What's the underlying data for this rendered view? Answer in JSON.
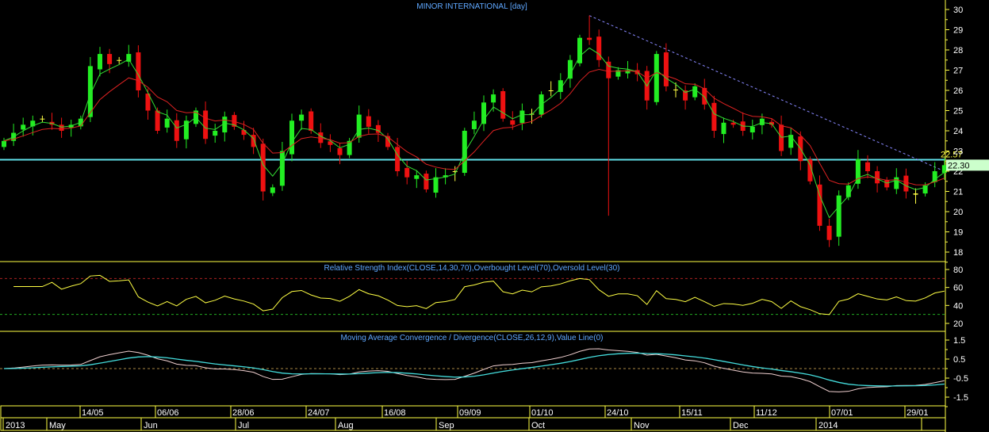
{
  "chart_data": {
    "type": "candlestick",
    "title": "MINOR INTERNATIONAL [day]",
    "price_axis": {
      "ticks": [
        18,
        19,
        20,
        21,
        22,
        23,
        24,
        25,
        26,
        27,
        28,
        29,
        30
      ],
      "range": [
        17.7,
        30.5
      ]
    },
    "closes": [
      23.5,
      23.9,
      24.3,
      24.5,
      24.6,
      24.3,
      24.0,
      24.3,
      24.6,
      27.2,
      27.8,
      27.3,
      27.5,
      27.8,
      26.0,
      25.0,
      24.0,
      24.6,
      23.5,
      24.5,
      25.0,
      23.6,
      24.0,
      24.7,
      24.2,
      23.8,
      23.2,
      21.0,
      21.2,
      23.0,
      24.5,
      24.8,
      24.0,
      23.4,
      23.3,
      22.8,
      23.5,
      24.8,
      24.2,
      23.9,
      23.2,
      22.0,
      21.7,
      21.8,
      21.1,
      21.7,
      21.8,
      22.0,
      24.0,
      24.5,
      25.4,
      25.8,
      24.6,
      24.3,
      25.0,
      24.8,
      25.8,
      26.0,
      26.5,
      27.5,
      28.6,
      28.5,
      27.5,
      26.6,
      27.0,
      27.0,
      26.8,
      25.5,
      27.8,
      26.2,
      26.0,
      25.5,
      26.2,
      25.3,
      24.0,
      24.4,
      24.3,
      24.0,
      24.2,
      24.6,
      24.3,
      23.0,
      23.8,
      22.5,
      21.5,
      19.3,
      18.6,
      20.8,
      21.3,
      22.6,
      22.0,
      21.4,
      21.2,
      21.7,
      21.0,
      20.9,
      21.3,
      22.0,
      22.3
    ],
    "outlier_low": {
      "index": 63,
      "value": 19.8
    },
    "swing_high": {
      "index": 61,
      "value": 29.7
    },
    "horizontal_line": {
      "value": 22.57,
      "label": "22.57",
      "color": "#5fe0e8"
    },
    "last_price": {
      "value": 22.3,
      "label": "22.30"
    },
    "trendline": {
      "from": {
        "index": 61,
        "value": 29.7
      },
      "to": {
        "index": 98,
        "value": 22.0
      }
    },
    "moving_averages": [
      {
        "period": 3,
        "color": "#33dd33"
      },
      {
        "period": 8,
        "color": "#dd2222"
      }
    ],
    "rsi": {
      "title": "Relative Strength Index(CLOSE,14,30,70),Overbought Level(70),Oversold Level(30)",
      "period": 14,
      "overbought": 70,
      "oversold": 30,
      "ticks": [
        20,
        40,
        60,
        80
      ],
      "range": [
        10,
        85
      ]
    },
    "macd": {
      "title": "Moving Average Convergence / Divergence(CLOSE,26,12,9),Value Line(0)",
      "slow": 26,
      "fast": 12,
      "signal": 9,
      "value_line": 0,
      "ticks": [
        "1.5",
        "0.5",
        "-0.5",
        "-1.5"
      ],
      "range": [
        -2,
        2
      ]
    },
    "date_ticks": [
      "14/05",
      "06/06",
      "28/06",
      "24/07",
      "16/08",
      "09/09",
      "01/10",
      "24/10",
      "15/11",
      "11/12",
      "07/01",
      "29/01"
    ],
    "period_labels": [
      "2013",
      "May",
      "Jun",
      "Jul",
      "Aug",
      "Sep",
      "Oct",
      "Nov",
      "Dec",
      "2014"
    ],
    "colors": {
      "up": "#22ee22",
      "down": "#ee1111",
      "doji": "#ffff44",
      "axis": "#ffff44",
      "title": "#5fa8ff",
      "trend": "#8888ff"
    }
  }
}
